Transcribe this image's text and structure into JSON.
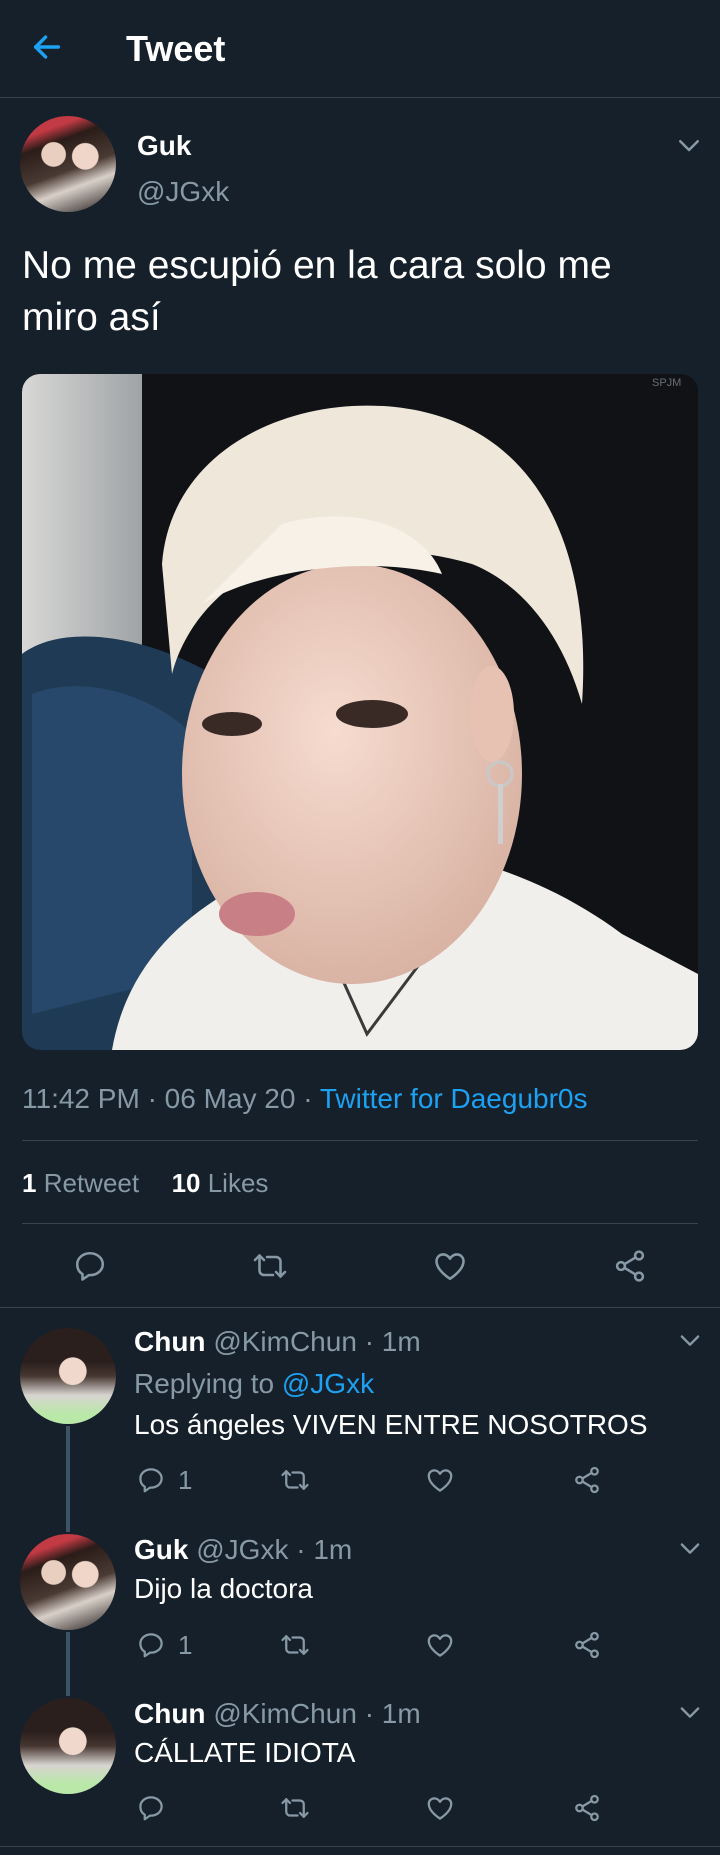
{
  "header": {
    "title": "Tweet"
  },
  "tweet": {
    "name": "Guk",
    "handle": "@JGxk",
    "text": "No me escupió en la cara solo me miro así",
    "image_watermark": "SPJM",
    "time": "11:42 PM",
    "date": "06 May 20",
    "dot": "·",
    "source": "Twitter for Daegubr0s",
    "retweets_count": "1",
    "retweets_label": "Retweet",
    "likes_count": "10",
    "likes_label": "Likes"
  },
  "replies": [
    {
      "name": "Chun",
      "handle": "@KimChun",
      "time": "· 1m",
      "replying_prefix": "Replying to",
      "replying_to": "@JGxk",
      "text": "Los ángeles VIVEN ENTRE NOSOTROS",
      "reply_count": "1"
    },
    {
      "name": "Guk",
      "handle": "@JGxk",
      "time": "· 1m",
      "text": "Dijo la doctora",
      "reply_count": "1"
    },
    {
      "name": "Chun",
      "handle": "@KimChun",
      "time": "· 1m",
      "text": "CÁLLATE IDIOTA",
      "reply_count": ""
    }
  ],
  "colors": {
    "background": "#15202b",
    "accent": "#1da1f2",
    "muted": "#8899a6",
    "separator": "#38444d"
  },
  "icons": [
    "back-arrow-icon",
    "chevron-down-icon",
    "reply-icon",
    "retweet-icon",
    "like-icon",
    "share-icon"
  ]
}
